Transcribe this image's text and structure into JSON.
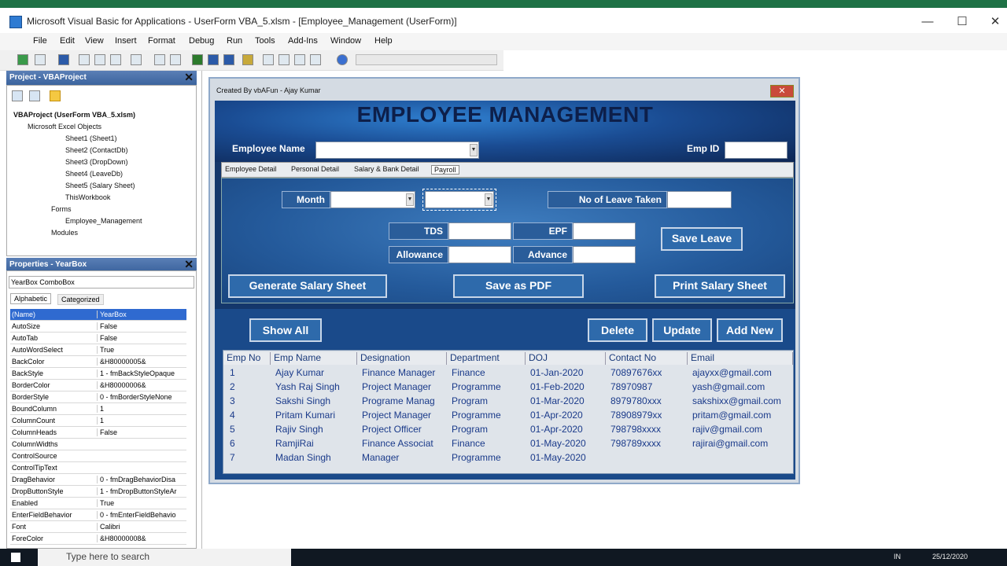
{
  "window": {
    "title": "Microsoft Visual Basic for Applications - UserForm VBA_5.xlsm - [Employee_Management (UserForm)]",
    "min": "—",
    "max": "☐",
    "close": "✕"
  },
  "menu": [
    "File",
    "Edit",
    "View",
    "Insert",
    "Format",
    "Debug",
    "Run",
    "Tools",
    "Add-Ins",
    "Window",
    "Help"
  ],
  "project": {
    "header": "Project - VBAProject",
    "close": "✕",
    "tree": [
      "VBAProject (UserForm VBA_5.xlsm)",
      "Microsoft Excel Objects",
      "Sheet1 (Sheet1)",
      "Sheet2 (ContactDb)",
      "Sheet3 (DropDown)",
      "Sheet4 (LeaveDb)",
      "Sheet5 (Salary Sheet)",
      "ThisWorkbook",
      "Forms",
      "Employee_Management",
      "Modules"
    ]
  },
  "properties": {
    "header": "Properties - YearBox",
    "close": "✕",
    "object": "YearBox ComboBox",
    "tab_alpha": "Alphabetic",
    "tab_cat": "Categorized",
    "rows": [
      [
        "(Name)",
        "YearBox"
      ],
      [
        "AutoSize",
        "False"
      ],
      [
        "AutoTab",
        "False"
      ],
      [
        "AutoWordSelect",
        "True"
      ],
      [
        "BackColor",
        "&H80000005&"
      ],
      [
        "BackStyle",
        "1 - fmBackStyleOpaque"
      ],
      [
        "BorderColor",
        "&H80000006&"
      ],
      [
        "BorderStyle",
        "0 - fmBorderStyleNone"
      ],
      [
        "BoundColumn",
        "1"
      ],
      [
        "ColumnCount",
        "1"
      ],
      [
        "ColumnHeads",
        "False"
      ],
      [
        "ColumnWidths",
        ""
      ],
      [
        "ControlSource",
        ""
      ],
      [
        "ControlTipText",
        ""
      ],
      [
        "DragBehavior",
        "0 - fmDragBehaviorDisa"
      ],
      [
        "DropButtonStyle",
        "1 - fmDropButtonStyleAr"
      ],
      [
        "Enabled",
        "True"
      ],
      [
        "EnterFieldBehavior",
        "0 - fmEnterFieldBehavio"
      ],
      [
        "Font",
        "Calibri"
      ],
      [
        "ForeColor",
        "&H80000008&"
      ]
    ]
  },
  "form": {
    "caption": "Created By vbAFun - Ajay Kumar",
    "close": "✕",
    "title": "EMPLOYEE MANAGEMENT",
    "emp_name_label": "Employee Name",
    "emp_id_label": "Emp ID",
    "tabs": [
      "Employee Detail",
      "Personal Detail",
      "Salary & Bank Detail",
      "Payroll"
    ],
    "month_label": "Month",
    "leave_label": "No of Leave Taken",
    "tds_label": "TDS",
    "epf_label": "EPF",
    "allowance_label": "Allowance",
    "advance_label": "Advance",
    "save_leave": "Save Leave",
    "gen_salary": "Generate Salary Sheet",
    "save_pdf": "Save as PDF",
    "print_salary": "Print Salary Sheet",
    "show_all": "Show All",
    "delete": "Delete",
    "update": "Update",
    "add_new": "Add New"
  },
  "list": {
    "headers": [
      "Emp No",
      "Emp Name",
      "Designation",
      "Department",
      "DOJ",
      "Contact No",
      "Email"
    ],
    "rows": [
      [
        "1",
        "Ajay Kumar",
        "Finance Manager",
        "Finance",
        "01-Jan-2020",
        "70897676xx",
        "ajayxx@gmail.com"
      ],
      [
        "2",
        "Yash Raj Singh",
        "Project Manager",
        "Programme",
        "01-Feb-2020",
        "78970987",
        "yash@gmail.com"
      ],
      [
        "3",
        "Sakshi Singh",
        "Programe Manag",
        "Program",
        "01-Mar-2020",
        "8979780xxx",
        "sakshixx@gmail.com"
      ],
      [
        "4",
        "Pritam Kumari",
        "Project Manager",
        "Programme",
        "01-Apr-2020",
        "78908979xx",
        "pritam@gmail.com"
      ],
      [
        "5",
        "Rajiv Singh",
        "Project Officer",
        "Program",
        "01-Apr-2020",
        "798798xxxx",
        "rajiv@gmail.com"
      ],
      [
        "6",
        "RamjiRai",
        "Finance Associat",
        "Finance",
        "01-May-2020",
        "798789xxxx",
        "rajirai@gmail.com"
      ],
      [
        "7",
        "Madan Singh",
        "Manager",
        "Programme",
        "01-May-2020",
        "",
        ""
      ]
    ]
  },
  "taskbar": {
    "search": "Type here to search",
    "lang": "IN",
    "date": "25/12/2020"
  }
}
